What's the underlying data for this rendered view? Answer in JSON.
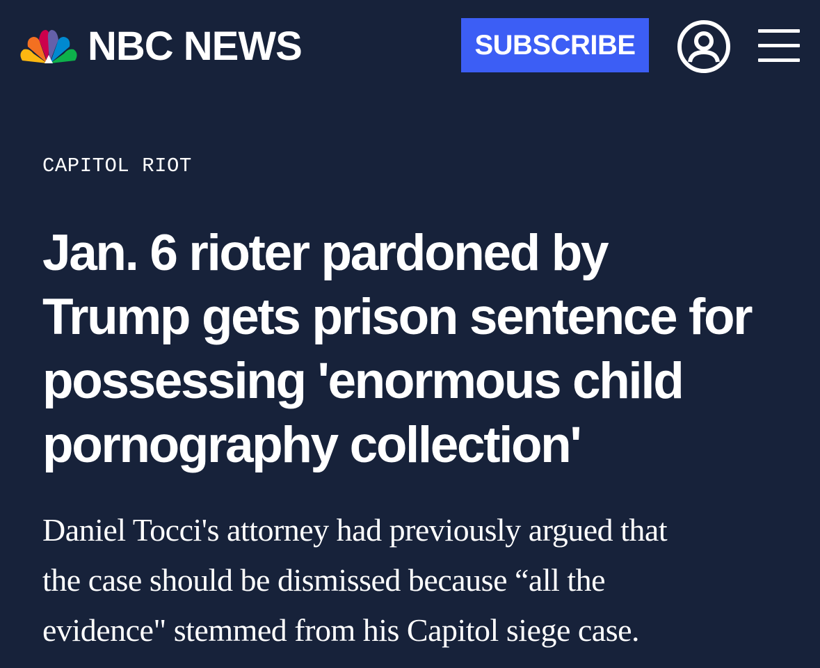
{
  "header": {
    "brand": "NBC NEWS",
    "logo_icon": "nbc-peacock-icon",
    "subscribe_label": "SUBSCRIBE",
    "account_icon": "user-account-icon",
    "menu_icon": "hamburger-menu-icon"
  },
  "article": {
    "kicker": "CAPITOL RIOT",
    "headline_lines": [
      "Jan. 6 rioter pardoned by",
      "Trump gets prison sentence for",
      "possessing 'enormous child",
      "pornography collection'"
    ],
    "dek_lines": [
      "Daniel Tocci's attorney had previously argued that",
      "the case should be dismissed because “all the",
      "evidence\" stemmed from his Capitol siege case."
    ]
  },
  "colors": {
    "background": "#17223a",
    "subscribe_button": "#3c5ef5",
    "text": "#ffffff",
    "peacock_yellow": "#fcb711",
    "peacock_orange": "#f37021",
    "peacock_red": "#cc004c",
    "peacock_purple": "#6460aa",
    "peacock_blue": "#0089d0",
    "peacock_green": "#0db14b"
  }
}
